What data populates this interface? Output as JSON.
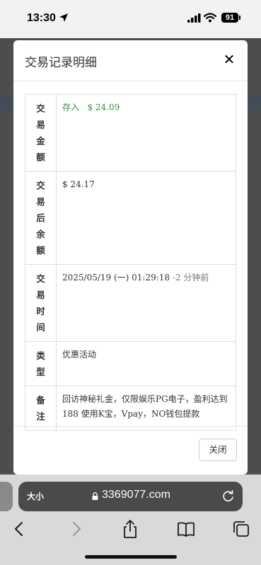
{
  "status": {
    "time": "13:30",
    "battery": "91"
  },
  "modal": {
    "title": "交易记录明细",
    "rows": [
      {
        "label": "交易金额",
        "type": "amount",
        "prefix": "存入",
        "value": "$ 24.09"
      },
      {
        "label": "交易后余额",
        "type": "text",
        "value": "$ 24.17"
      },
      {
        "label": "交易时间",
        "type": "time",
        "value": "2025/05/19 (一) 01:29:18",
        "relative": "-2 分钟前"
      },
      {
        "label": "类型",
        "type": "text",
        "value": "优惠活动"
      },
      {
        "label": "备注",
        "type": "text",
        "value": "回访神秘礼金，仅限娱乐PG电子，盈利达到188 使用K宝，Vpay，NO钱包提款"
      }
    ],
    "close_label": "关闭"
  },
  "browser": {
    "text_size": "大小",
    "url": "3369077.com"
  },
  "colors": {
    "deposit": "#3c8d3c"
  }
}
